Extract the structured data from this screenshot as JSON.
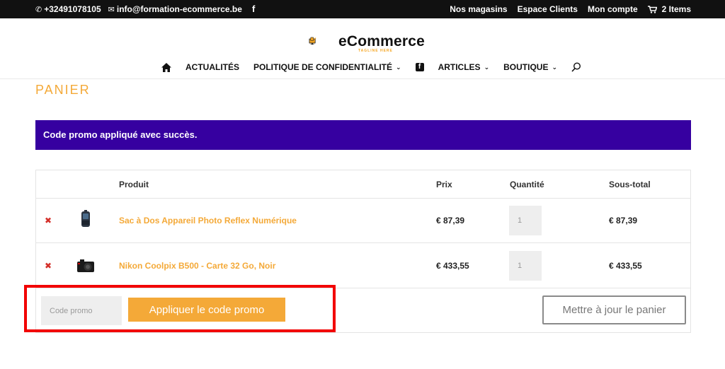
{
  "topbar": {
    "phone": "+32491078105",
    "email": "info@formation-ecommerce.be",
    "links": [
      "Nos magasins",
      "Espace Clients",
      "Mon compte"
    ],
    "cart_label": "2 Items"
  },
  "logo": {
    "text": "eCommerce",
    "tagline": "TAGLINE HERE"
  },
  "nav": {
    "items": [
      "ACTUALITÉS",
      "POLITIQUE DE CONFIDENTIALITÉ",
      "ARTICLES",
      "BOUTIQUE"
    ]
  },
  "page": {
    "title": "PANIER",
    "notice": "Code promo appliqué avec succès."
  },
  "cart": {
    "headers": {
      "product": "Produit",
      "price": "Prix",
      "quantity": "Quantité",
      "subtotal": "Sous-total"
    },
    "items": [
      {
        "name": "Sac à Dos Appareil Photo Reflex Numérique",
        "price": "€ 87,39",
        "quantity": "1",
        "subtotal": "€ 87,39",
        "thumb_icon": "backpack-icon"
      },
      {
        "name": "Nikon Coolpix B500 - Carte 32 Go, Noir",
        "price": "€ 433,55",
        "quantity": "1",
        "subtotal": "€ 433,55",
        "thumb_icon": "camera-icon"
      }
    ],
    "coupon_placeholder": "Code promo",
    "apply_label": "Appliquer le code promo",
    "update_label": "Mettre à jour le panier"
  },
  "colors": {
    "accent": "#f4a938",
    "notice_bg": "#3600a0",
    "topbar_bg": "#111111",
    "remove": "#d4302a",
    "highlight": "#f20000"
  }
}
